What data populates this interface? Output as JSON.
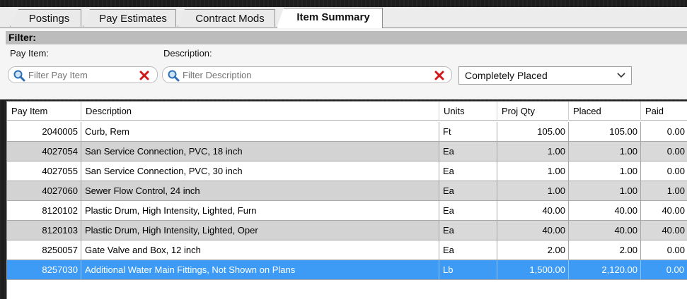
{
  "tabs": [
    {
      "label": "Postings"
    },
    {
      "label": "Pay Estimates"
    },
    {
      "label": "Contract Mods"
    },
    {
      "label": "Item Summary"
    }
  ],
  "filter": {
    "title": "Filter:",
    "pay_item_label": "Pay Item:",
    "pay_item_placeholder": "Filter Pay Item",
    "description_label": "Description:",
    "description_placeholder": "Filter Description",
    "status_selected": "Completely Placed"
  },
  "grid": {
    "columns": [
      "Pay Item",
      "Description",
      "Units",
      "Proj Qty",
      "Placed",
      "Paid"
    ],
    "rows": [
      {
        "item": "2040005",
        "desc": "Curb, Rem",
        "units": "Ft",
        "proj": "105.00",
        "placed": "105.00",
        "paid": "0.00"
      },
      {
        "item": "4027054",
        "desc": "San Service Connection, PVC, 18 inch",
        "units": "Ea",
        "proj": "1.00",
        "placed": "1.00",
        "paid": "0.00"
      },
      {
        "item": "4027055",
        "desc": "San Service Connection, PVC, 30 inch",
        "units": "Ea",
        "proj": "1.00",
        "placed": "1.00",
        "paid": "0.00"
      },
      {
        "item": "4027060",
        "desc": "Sewer Flow Control, 24 inch",
        "units": "Ea",
        "proj": "1.00",
        "placed": "1.00",
        "paid": "1.00"
      },
      {
        "item": "8120102",
        "desc": "Plastic Drum, High Intensity, Lighted, Furn",
        "units": "Ea",
        "proj": "40.00",
        "placed": "40.00",
        "paid": "40.00"
      },
      {
        "item": "8120103",
        "desc": "Plastic Drum, High Intensity, Lighted, Oper",
        "units": "Ea",
        "proj": "40.00",
        "placed": "40.00",
        "paid": "40.00"
      },
      {
        "item": "8250057",
        "desc": "Gate Valve and Box, 12 inch",
        "units": "Ea",
        "proj": "2.00",
        "placed": "2.00",
        "paid": "0.00"
      },
      {
        "item": "8257030",
        "desc": "Additional Water Main Fittings, Not Shown on Plans",
        "units": "Lb",
        "proj": "1,500.00",
        "placed": "2,120.00",
        "paid": "0.00"
      }
    ]
  },
  "colors": {
    "selected_row": "#3d9bf5",
    "alt_row": "#d3d3d3",
    "clear_icon": "#d0191b",
    "search_icon": "#2f6fb7"
  }
}
